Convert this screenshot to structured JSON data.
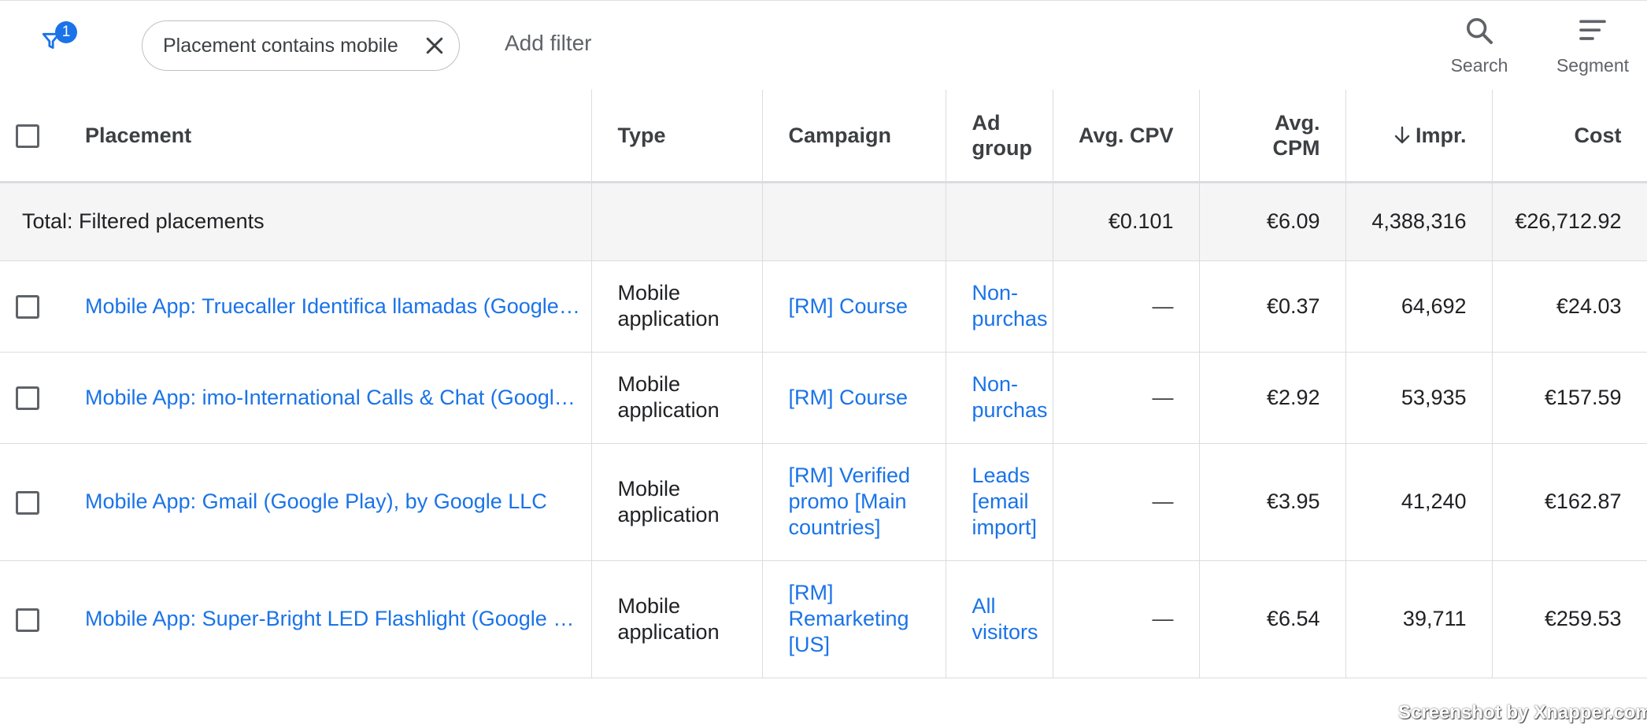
{
  "filter_bar": {
    "filter_count": "1",
    "chip_label": "Placement contains mobile",
    "add_filter_label": "Add filter",
    "search_label": "Search",
    "segment_label": "Segment"
  },
  "table": {
    "headers": {
      "placement": "Placement",
      "type": "Type",
      "campaign": "Campaign",
      "ad_group": "Ad group",
      "avg_cpv": "Avg. CPV",
      "avg_cpm": "Avg. CPM",
      "impr": "Impr.",
      "cost": "Cost"
    },
    "total": {
      "label": "Total: Filtered placements",
      "avg_cpv": "€0.101",
      "avg_cpm": "€6.09",
      "impr": "4,388,316",
      "cost": "€26,712.92"
    },
    "rows": [
      {
        "placement": "Mobile App: Truecaller Identifica llamadas (Google Play), by Truecaller",
        "type": "Mobile application",
        "campaign": "[RM] Course",
        "ad_group": "Non-purchas",
        "avg_cpv": "—",
        "avg_cpm": "€0.37",
        "impr": "64,692",
        "cost": "€24.03"
      },
      {
        "placement": "Mobile App: imo-International Calls & Chat (Google Play)",
        "type": "Mobile application",
        "campaign": "[RM] Course",
        "ad_group": "Non-purchas",
        "avg_cpv": "—",
        "avg_cpm": "€2.92",
        "impr": "53,935",
        "cost": "€157.59"
      },
      {
        "placement": "Mobile App: Gmail (Google Play), by Google LLC",
        "type": "Mobile application",
        "campaign": "[RM] Verified promo [Main countries]",
        "ad_group": "Leads [email import]",
        "avg_cpv": "—",
        "avg_cpm": "€3.95",
        "impr": "41,240",
        "cost": "€162.87"
      },
      {
        "placement": "Mobile App: Super-Bright LED Flashlight (Google Play)",
        "type": "Mobile application",
        "campaign": "[RM] Remarketing [US]",
        "ad_group": "All visitors",
        "avg_cpv": "—",
        "avg_cpm": "€6.54",
        "impr": "39,711",
        "cost": "€259.53"
      }
    ]
  },
  "watermark": "Screenshot by Xnapper.com",
  "colors": {
    "link": "#1a73e8",
    "accent": "#1a73e8",
    "total_row_bg": "#f5f5f5"
  }
}
